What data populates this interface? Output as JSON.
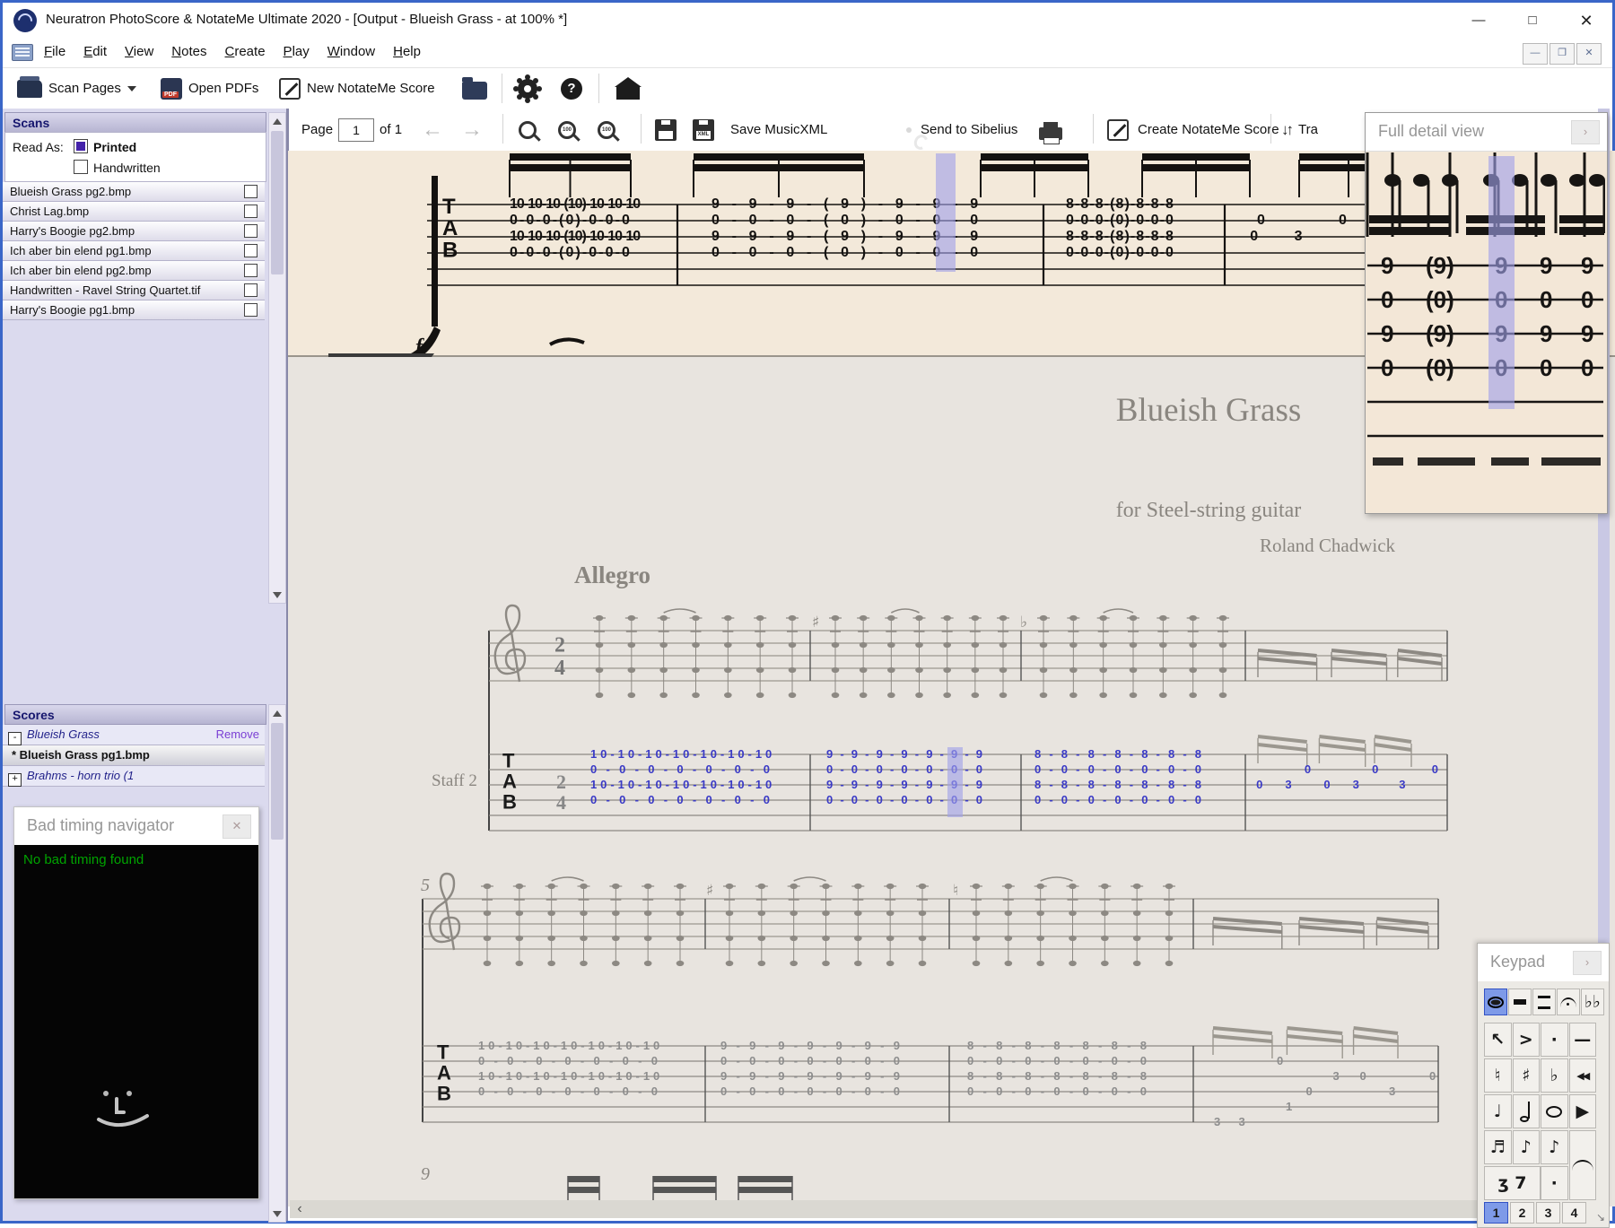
{
  "window": {
    "title": "Neuratron PhotoScore & NotateMe Ultimate 2020 - [Output - Blueish Grass - at 100% *]"
  },
  "menu": {
    "items": [
      "File",
      "Edit",
      "View",
      "Notes",
      "Create",
      "Play",
      "Window",
      "Help"
    ]
  },
  "toolbar": {
    "scan_pages": "Scan Pages",
    "open_pdfs": "Open PDFs",
    "new_notateme": "New NotateMe Score"
  },
  "toolbar2": {
    "page_label": "Page",
    "page_value": "1",
    "page_of": "of 1",
    "save_musicxml": "Save MusicXML",
    "send_to_sibelius": "Send to Sibelius",
    "create_notateme": "Create NotateMe Score",
    "transpose_partial": "Tra"
  },
  "scans_panel": {
    "header": "Scans",
    "read_as": "Read As:",
    "printed": "Printed",
    "handwritten": "Handwritten",
    "files": [
      "Blueish Grass pg2.bmp",
      "Christ Lag.bmp",
      "Harry's Boogie pg2.bmp",
      "Ich aber bin elend pg1.bmp",
      "Ich aber bin elend pg2.bmp",
      "Handwritten - Ravel String Quartet.tif",
      "Harry's Boogie pg1.bmp"
    ]
  },
  "scores_panel": {
    "header": "Scores",
    "remove": "Remove",
    "items": [
      {
        "label": "Blueish Grass",
        "expander": "-",
        "style": "group"
      },
      {
        "label": "* Blueish Grass pg1.bmp",
        "expander": "",
        "style": "selected"
      },
      {
        "label": "Brahms - horn trio (1",
        "expander": "+",
        "style": "group"
      }
    ]
  },
  "bad_timing": {
    "title": "Bad timing navigator",
    "message": "No bad timing found"
  },
  "score_page": {
    "title": "Blueish Grass",
    "subtitle": "for Steel-string guitar",
    "composer": "Roland Chadwick",
    "tempo": "Allegro",
    "staff_label": "Staff 2",
    "time_signature": {
      "num": "2",
      "den": "4"
    },
    "next_system_marker": "9",
    "systems": [
      {
        "marker": "",
        "tab_color": "#3a3ac6",
        "accidentals": [
          "",
          "♯",
          "♭",
          ""
        ],
        "bars": [
          {
            "rows": [
              "10-10-10-10-10-10-10",
              "0-0-0-0-0-0-0",
              "10-10-10-10-10-10-10",
              "0-0-0-0-0-0-0"
            ]
          },
          {
            "rows": [
              "9-9-9-9-9-9-9",
              "0-0-0-0-0-0-0",
              "9-9-9-9-9-9-9",
              "0-0-0-0-0-0-0"
            ],
            "highlight": true
          },
          {
            "rows": [
              "8-8-8-8-8-8-8",
              "0-0-0-0-0-0-0",
              "8-8-8-8-8-8-8",
              "0-0-0-0-0-0-0"
            ]
          },
          {
            "riff": [
              {
                "row": 1,
                "fx": 0.26,
                "v": "0"
              },
              {
                "row": 1,
                "fx": 0.61,
                "v": "0"
              },
              {
                "row": 1,
                "fx": 0.92,
                "v": "0"
              },
              {
                "row": 2,
                "fx": 0.01,
                "v": "0"
              },
              {
                "row": 2,
                "fx": 0.16,
                "v": "3"
              },
              {
                "row": 2,
                "fx": 0.36,
                "v": "0"
              },
              {
                "row": 2,
                "fx": 0.51,
                "v": "3"
              },
              {
                "row": 2,
                "fx": 0.75,
                "v": "3"
              }
            ]
          }
        ]
      },
      {
        "marker": "5",
        "tab_color": "#8d8d8d",
        "accidentals": [
          "",
          "♯",
          "♮",
          ""
        ],
        "bars": [
          {
            "rows": [
              "10-10-10-10-10-10-10",
              "0-0-0-0-0-0-0",
              "10-10-10-10-10-10-10",
              "0-0-0-0-0-0-0"
            ]
          },
          {
            "rows": [
              "9-9-9-9-9-9-9",
              "0-0-0-0-0-0-0",
              "9-9-9-9-9-9-9",
              "0-0-0-0-0-0-0"
            ]
          },
          {
            "rows": [
              "8-8-8-8-8-8-8",
              "0-0-0-0-0-0-0",
              "8-8-8-8-8-8-8",
              "0-0-0-0-0-0-0"
            ]
          },
          {
            "riff": [
              {
                "row": 1,
                "fx": 0.3,
                "v": "0"
              },
              {
                "row": 2,
                "fx": 0.55,
                "v": "3"
              },
              {
                "row": 2,
                "fx": 0.67,
                "v": "0"
              },
              {
                "row": 2,
                "fx": 0.98,
                "v": "0"
              },
              {
                "row": 3,
                "fx": 0.43,
                "v": "0"
              },
              {
                "row": 3,
                "fx": 0.8,
                "v": "3"
              },
              {
                "row": 4,
                "fx": 0.34,
                "v": "1"
              },
              {
                "row": 5,
                "fx": 0.02,
                "v": "3"
              },
              {
                "row": 5,
                "fx": 0.13,
                "v": "3"
              }
            ]
          }
        ]
      }
    ]
  },
  "scan_strip": {
    "bars": [
      {
        "rows": [
          "10-10-10-(10)-10-10-10",
          "0-0-0-(0)-0-0-0",
          "10-10-10-(10)-10-10-10",
          "0-0-0-(0)-0-0-0"
        ]
      },
      {
        "rows": [
          "9-9-9-(9)-9-9-9",
          "0-0-0-(0)-0-0-0",
          "9-9-9-(9)-9-9-9",
          "0-0-0-(0)-0-0-0"
        ],
        "highlight": true
      },
      {
        "rows": [
          "8-8-8-(8)-8-8-8",
          "0-0-0-(0)-0-0-0",
          "8-8-8-(8)-8-8-8",
          "0-0-0-(0)-0-0-0"
        ]
      },
      {
        "riff": [
          {
            "row": 1,
            "fx": 0.1,
            "v": "0"
          },
          {
            "row": 2,
            "fx": 0.04,
            "v": "0"
          },
          {
            "row": 2,
            "fx": 0.42,
            "v": "3"
          },
          {
            "row": 1,
            "fx": 0.8,
            "v": "0"
          }
        ]
      }
    ]
  },
  "full_detail": {
    "title": "Full detail view",
    "tab": {
      "rows": [
        "9",
        "0",
        "9",
        "0"
      ],
      "cols": 5,
      "paren_col": 1,
      "highlight_col": 2
    }
  },
  "keypad": {
    "title": "Keypad",
    "modes": [
      {
        "name": "whole-note-mode",
        "kind": "oval",
        "selected": true
      },
      {
        "name": "breve-mode",
        "kind": "bar"
      },
      {
        "name": "double-bar-mode",
        "kind": "dbar"
      },
      {
        "name": "fermata-mode",
        "kind": "arc"
      },
      {
        "name": "double-flat-mode",
        "kind": "text",
        "glyph": "♭♭"
      }
    ],
    "grid": [
      [
        {
          "name": "pointer",
          "glyph": "↖"
        },
        {
          "name": "accent",
          "glyph": ">"
        },
        {
          "name": "staccato",
          "glyph": "·"
        },
        {
          "name": "tenuto",
          "glyph": "—"
        }
      ],
      [
        {
          "name": "natural",
          "glyph": "♮"
        },
        {
          "name": "sharp",
          "glyph": "♯"
        },
        {
          "name": "flat",
          "glyph": "♭"
        },
        {
          "name": "rewind",
          "glyph": "◀◀",
          "small": true
        }
      ],
      [
        {
          "name": "quarter-note",
          "glyph": "♩"
        },
        {
          "name": "half-note",
          "kind": "half"
        },
        {
          "name": "whole-note",
          "kind": "oval"
        },
        {
          "name": "play",
          "glyph": "▶"
        }
      ],
      [
        {
          "name": "sixteenth-note",
          "glyph": "♬"
        },
        {
          "name": "eighth-note",
          "glyph": "♪"
        },
        {
          "name": "eighth-note-alt",
          "glyph": "♪"
        },
        {
          "name": "slur",
          "kind": "slur",
          "rowspan": 2
        }
      ],
      [
        {
          "name": "rests",
          "glyph": "ʒ 7",
          "colspan": 2
        },
        null,
        {
          "name": "augmentation-dot",
          "glyph": "·"
        },
        null
      ]
    ],
    "voices": [
      "1",
      "2",
      "3",
      "4"
    ],
    "selected_voice_index": 0
  }
}
